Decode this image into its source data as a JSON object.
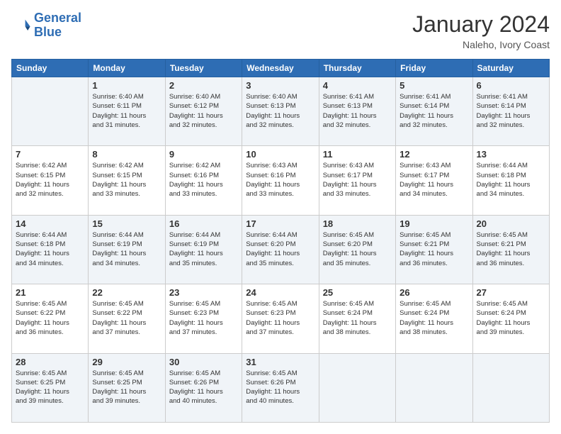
{
  "header": {
    "logo_line1": "General",
    "logo_line2": "Blue",
    "month_title": "January 2024",
    "location": "Naleho, Ivory Coast"
  },
  "days_of_week": [
    "Sunday",
    "Monday",
    "Tuesday",
    "Wednesday",
    "Thursday",
    "Friday",
    "Saturday"
  ],
  "weeks": [
    [
      {
        "day": "",
        "info": ""
      },
      {
        "day": "1",
        "info": "Sunrise: 6:40 AM\nSunset: 6:11 PM\nDaylight: 11 hours\nand 31 minutes."
      },
      {
        "day": "2",
        "info": "Sunrise: 6:40 AM\nSunset: 6:12 PM\nDaylight: 11 hours\nand 32 minutes."
      },
      {
        "day": "3",
        "info": "Sunrise: 6:40 AM\nSunset: 6:13 PM\nDaylight: 11 hours\nand 32 minutes."
      },
      {
        "day": "4",
        "info": "Sunrise: 6:41 AM\nSunset: 6:13 PM\nDaylight: 11 hours\nand 32 minutes."
      },
      {
        "day": "5",
        "info": "Sunrise: 6:41 AM\nSunset: 6:14 PM\nDaylight: 11 hours\nand 32 minutes."
      },
      {
        "day": "6",
        "info": "Sunrise: 6:41 AM\nSunset: 6:14 PM\nDaylight: 11 hours\nand 32 minutes."
      }
    ],
    [
      {
        "day": "7",
        "info": "Sunrise: 6:42 AM\nSunset: 6:15 PM\nDaylight: 11 hours\nand 32 minutes."
      },
      {
        "day": "8",
        "info": "Sunrise: 6:42 AM\nSunset: 6:15 PM\nDaylight: 11 hours\nand 33 minutes."
      },
      {
        "day": "9",
        "info": "Sunrise: 6:42 AM\nSunset: 6:16 PM\nDaylight: 11 hours\nand 33 minutes."
      },
      {
        "day": "10",
        "info": "Sunrise: 6:43 AM\nSunset: 6:16 PM\nDaylight: 11 hours\nand 33 minutes."
      },
      {
        "day": "11",
        "info": "Sunrise: 6:43 AM\nSunset: 6:17 PM\nDaylight: 11 hours\nand 33 minutes."
      },
      {
        "day": "12",
        "info": "Sunrise: 6:43 AM\nSunset: 6:17 PM\nDaylight: 11 hours\nand 34 minutes."
      },
      {
        "day": "13",
        "info": "Sunrise: 6:44 AM\nSunset: 6:18 PM\nDaylight: 11 hours\nand 34 minutes."
      }
    ],
    [
      {
        "day": "14",
        "info": "Sunrise: 6:44 AM\nSunset: 6:18 PM\nDaylight: 11 hours\nand 34 minutes."
      },
      {
        "day": "15",
        "info": "Sunrise: 6:44 AM\nSunset: 6:19 PM\nDaylight: 11 hours\nand 34 minutes."
      },
      {
        "day": "16",
        "info": "Sunrise: 6:44 AM\nSunset: 6:19 PM\nDaylight: 11 hours\nand 35 minutes."
      },
      {
        "day": "17",
        "info": "Sunrise: 6:44 AM\nSunset: 6:20 PM\nDaylight: 11 hours\nand 35 minutes."
      },
      {
        "day": "18",
        "info": "Sunrise: 6:45 AM\nSunset: 6:20 PM\nDaylight: 11 hours\nand 35 minutes."
      },
      {
        "day": "19",
        "info": "Sunrise: 6:45 AM\nSunset: 6:21 PM\nDaylight: 11 hours\nand 36 minutes."
      },
      {
        "day": "20",
        "info": "Sunrise: 6:45 AM\nSunset: 6:21 PM\nDaylight: 11 hours\nand 36 minutes."
      }
    ],
    [
      {
        "day": "21",
        "info": "Sunrise: 6:45 AM\nSunset: 6:22 PM\nDaylight: 11 hours\nand 36 minutes."
      },
      {
        "day": "22",
        "info": "Sunrise: 6:45 AM\nSunset: 6:22 PM\nDaylight: 11 hours\nand 37 minutes."
      },
      {
        "day": "23",
        "info": "Sunrise: 6:45 AM\nSunset: 6:23 PM\nDaylight: 11 hours\nand 37 minutes."
      },
      {
        "day": "24",
        "info": "Sunrise: 6:45 AM\nSunset: 6:23 PM\nDaylight: 11 hours\nand 37 minutes."
      },
      {
        "day": "25",
        "info": "Sunrise: 6:45 AM\nSunset: 6:24 PM\nDaylight: 11 hours\nand 38 minutes."
      },
      {
        "day": "26",
        "info": "Sunrise: 6:45 AM\nSunset: 6:24 PM\nDaylight: 11 hours\nand 38 minutes."
      },
      {
        "day": "27",
        "info": "Sunrise: 6:45 AM\nSunset: 6:24 PM\nDaylight: 11 hours\nand 39 minutes."
      }
    ],
    [
      {
        "day": "28",
        "info": "Sunrise: 6:45 AM\nSunset: 6:25 PM\nDaylight: 11 hours\nand 39 minutes."
      },
      {
        "day": "29",
        "info": "Sunrise: 6:45 AM\nSunset: 6:25 PM\nDaylight: 11 hours\nand 39 minutes."
      },
      {
        "day": "30",
        "info": "Sunrise: 6:45 AM\nSunset: 6:26 PM\nDaylight: 11 hours\nand 40 minutes."
      },
      {
        "day": "31",
        "info": "Sunrise: 6:45 AM\nSunset: 6:26 PM\nDaylight: 11 hours\nand 40 minutes."
      },
      {
        "day": "",
        "info": ""
      },
      {
        "day": "",
        "info": ""
      },
      {
        "day": "",
        "info": ""
      }
    ]
  ]
}
